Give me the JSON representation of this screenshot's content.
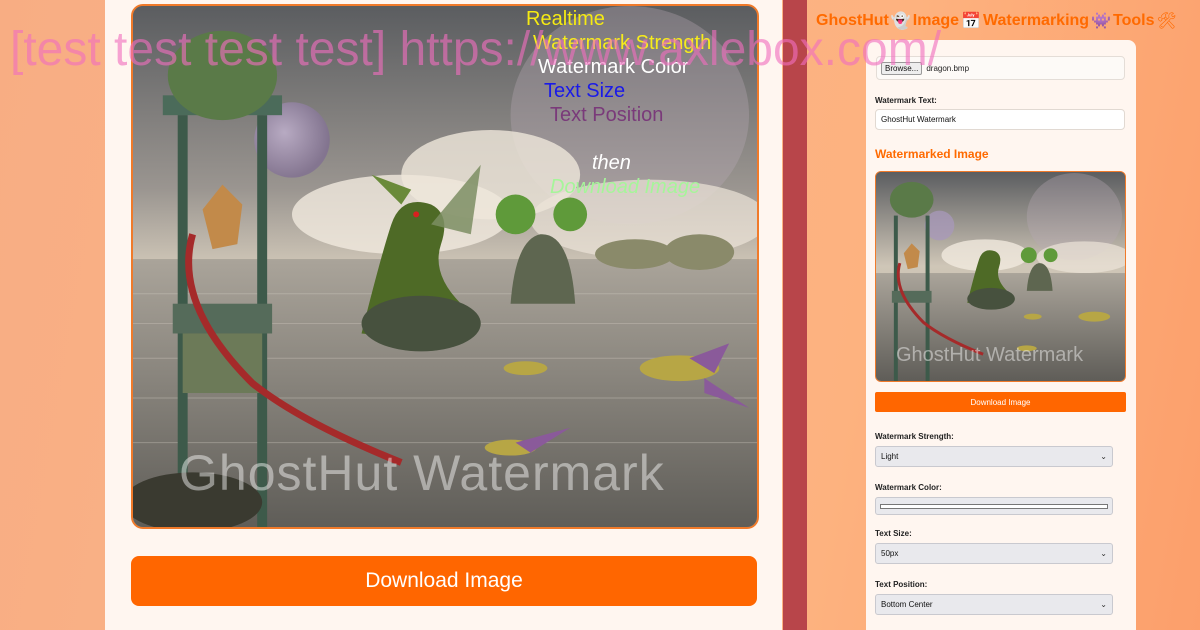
{
  "banner": {
    "text": "[test test test test] https://www.axlebox.com/"
  },
  "annotations": {
    "realtime": "Realtime",
    "strength": "Watermark Strength",
    "color": "Watermark Color",
    "size": "Text Size",
    "position": "Text Position",
    "then": "then",
    "download": "Download Image"
  },
  "preview": {
    "watermark_text": "GhostHut Watermark",
    "download_label": "Download Image"
  },
  "header": {
    "word1": "GhostHut",
    "icon1": "ghost-icon",
    "word2": "Image",
    "icon2": "calendar-icon",
    "word3": "Watermarking",
    "icon3": "alien-monster-icon",
    "word4": "Tools",
    "icon4": "hammer-wrench-icon"
  },
  "sidebar": {
    "browse_label": "Browse...",
    "file_name": "dragon.bmp",
    "watermark_text_label": "Watermark Text:",
    "watermark_text_value": "GhostHut Watermark",
    "watermarked_image_heading": "Watermarked Image",
    "download_label": "Download Image",
    "strength_label": "Watermark Strength:",
    "strength_value": "Light",
    "color_label": "Watermark Color:",
    "color_value": "#ffffff",
    "size_label": "Text Size:",
    "size_value": "50px",
    "position_label": "Text Position:",
    "position_value": "Bottom Center"
  }
}
